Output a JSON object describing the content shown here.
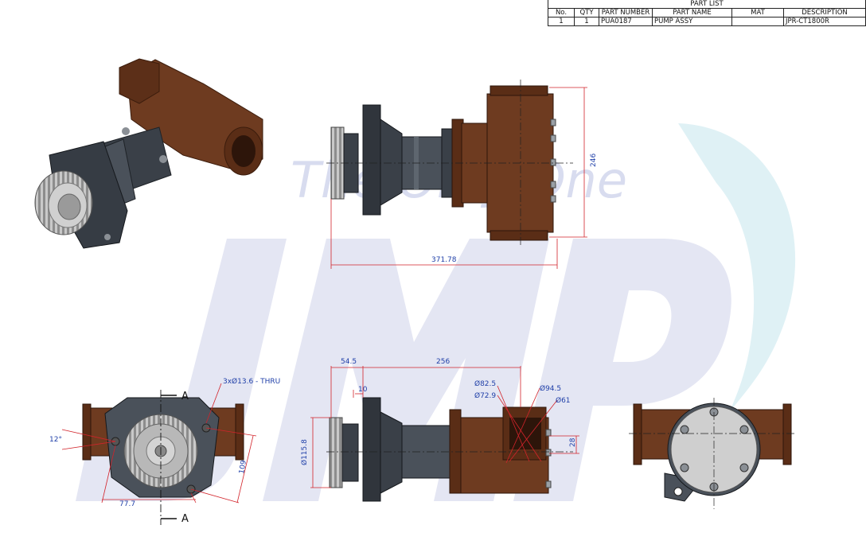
{
  "part_list": {
    "title": "PART LIST",
    "headers": [
      "No.",
      "QTY",
      "PART NUMBER",
      "PART NAME",
      "MAT",
      "DESCRIPTION"
    ],
    "rows": [
      [
        "1",
        "1",
        "PUA0187",
        "PUMP ASSY",
        "",
        "JPR-CT1800R"
      ]
    ]
  },
  "watermark": {
    "logo_text": "JMP",
    "tagline": "The Only One"
  },
  "dimensions": {
    "height_246": "246",
    "length_371": "371.78",
    "d_54_5": "54.5",
    "d_256": "256",
    "d_10": "10",
    "d_82_5": "Ø82.5",
    "d_72_9": "Ø72.9",
    "d_94_5": "Ø94.5",
    "d_61": "Ø61",
    "d_115_8": "Ø115.8",
    "d_28": "28",
    "holes": "3xØ13.6 - THRU",
    "angle_12": "12°",
    "d_77_7": "77.7",
    "d_109": "109",
    "section_a_top": "A",
    "section_a_bottom": "A"
  },
  "colors": {
    "bronze": "#6e3b20",
    "bronze_dark": "#4a2412",
    "steel_dark": "#3a4048",
    "steel_mid": "#5b636c",
    "gear": "#b8b8b8",
    "dimension_red": "#d2232a",
    "dimension_text": "#1f3fa8",
    "watermark_blue": "#e3e6f3",
    "watermark_teal": "#dff1f5"
  }
}
